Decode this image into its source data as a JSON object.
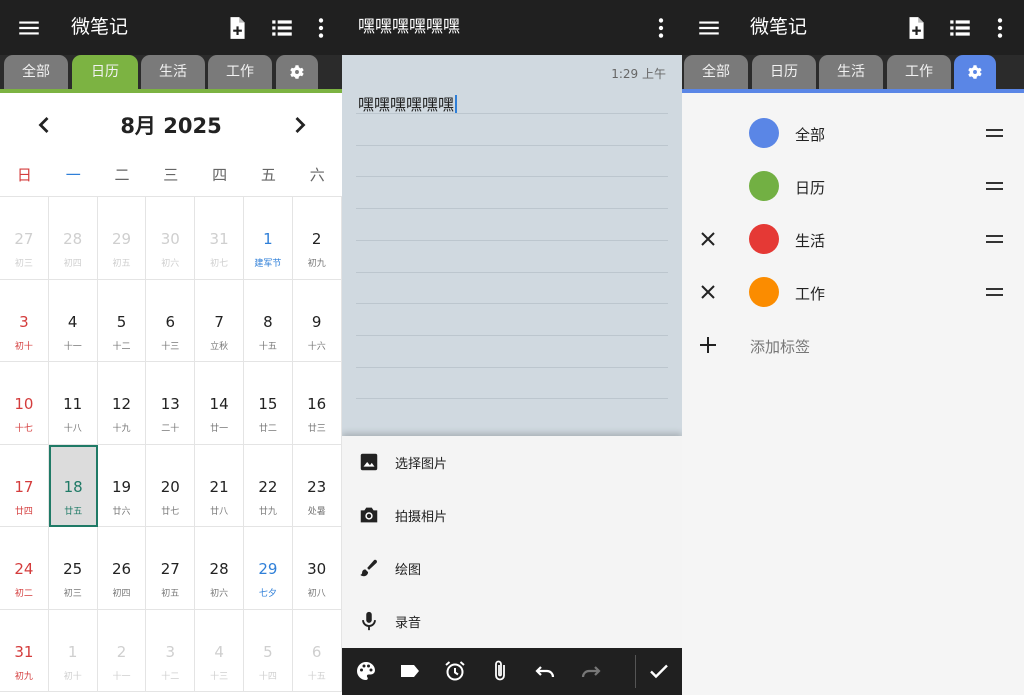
{
  "panel1": {
    "app_title": "微笔记",
    "tabs": [
      "全部",
      "日历",
      "生活",
      "工作"
    ],
    "active_tab": "日历",
    "calendar": {
      "month_title": "8月 2025",
      "weekdays": [
        "日",
        "一",
        "二",
        "三",
        "四",
        "五",
        "六"
      ],
      "cells": [
        {
          "day": "27",
          "lunar": "初三",
          "dim": true
        },
        {
          "day": "28",
          "lunar": "初四",
          "dim": true
        },
        {
          "day": "29",
          "lunar": "初五",
          "dim": true
        },
        {
          "day": "30",
          "lunar": "初六",
          "dim": true
        },
        {
          "day": "31",
          "lunar": "初七",
          "dim": true
        },
        {
          "day": "1",
          "lunar": "建军节",
          "festival": true
        },
        {
          "day": "2",
          "lunar": "初九"
        },
        {
          "day": "3",
          "lunar": "初十"
        },
        {
          "day": "4",
          "lunar": "十一"
        },
        {
          "day": "5",
          "lunar": "十二"
        },
        {
          "day": "6",
          "lunar": "十三"
        },
        {
          "day": "7",
          "lunar": "立秋"
        },
        {
          "day": "8",
          "lunar": "十五"
        },
        {
          "day": "9",
          "lunar": "十六"
        },
        {
          "day": "10",
          "lunar": "十七"
        },
        {
          "day": "11",
          "lunar": "十八"
        },
        {
          "day": "12",
          "lunar": "十九"
        },
        {
          "day": "13",
          "lunar": "二十"
        },
        {
          "day": "14",
          "lunar": "廿一"
        },
        {
          "day": "15",
          "lunar": "廿二"
        },
        {
          "day": "16",
          "lunar": "廿三"
        },
        {
          "day": "17",
          "lunar": "廿四"
        },
        {
          "day": "18",
          "lunar": "廿五",
          "today": true
        },
        {
          "day": "19",
          "lunar": "廿六"
        },
        {
          "day": "20",
          "lunar": "廿七"
        },
        {
          "day": "21",
          "lunar": "廿八"
        },
        {
          "day": "22",
          "lunar": "廿九"
        },
        {
          "day": "23",
          "lunar": "处暑"
        },
        {
          "day": "24",
          "lunar": "初二"
        },
        {
          "day": "25",
          "lunar": "初三"
        },
        {
          "day": "26",
          "lunar": "初四"
        },
        {
          "day": "27",
          "lunar": "初五"
        },
        {
          "day": "28",
          "lunar": "初六"
        },
        {
          "day": "29",
          "lunar": "七夕",
          "festival": true
        },
        {
          "day": "30",
          "lunar": "初八"
        },
        {
          "day": "31",
          "lunar": "初九"
        },
        {
          "day": "1",
          "lunar": "初十",
          "dim": true
        },
        {
          "day": "2",
          "lunar": "十一",
          "dim": true
        },
        {
          "day": "3",
          "lunar": "十二",
          "dim": true
        },
        {
          "day": "4",
          "lunar": "十三",
          "dim": true
        },
        {
          "day": "5",
          "lunar": "十四",
          "dim": true
        },
        {
          "day": "6",
          "lunar": "十五",
          "dim": true
        }
      ]
    }
  },
  "panel2": {
    "note_title": "嘿嘿嘿嘿嘿嘿",
    "timestamp": "1:29 上午",
    "note_text": "嘿嘿嘿嘿嘿嘿",
    "sheet_items": [
      {
        "label": "选择图片",
        "icon": "image-icon"
      },
      {
        "label": "拍摄相片",
        "icon": "camera-icon"
      },
      {
        "label": "绘图",
        "icon": "brush-icon"
      },
      {
        "label": "录音",
        "icon": "mic-icon"
      }
    ]
  },
  "panel3": {
    "app_title": "微笔记",
    "tabs": [
      "全部",
      "日历",
      "生活",
      "工作"
    ],
    "tags": [
      {
        "name": "全部",
        "color": "#5a86e6",
        "deletable": false
      },
      {
        "name": "日历",
        "color": "#72b043",
        "deletable": false
      },
      {
        "name": "生活",
        "color": "#e53935",
        "deletable": true
      },
      {
        "name": "工作",
        "color": "#fb8c00",
        "deletable": true
      }
    ],
    "add_tag_label": "添加标签"
  },
  "colors": {
    "calendar_accent": "#7cb342",
    "settings_accent": "#5a86e6",
    "today_border": "#1f7a66",
    "sunday_red": "#d43c3c",
    "festival_blue": "#2f7fd8"
  }
}
